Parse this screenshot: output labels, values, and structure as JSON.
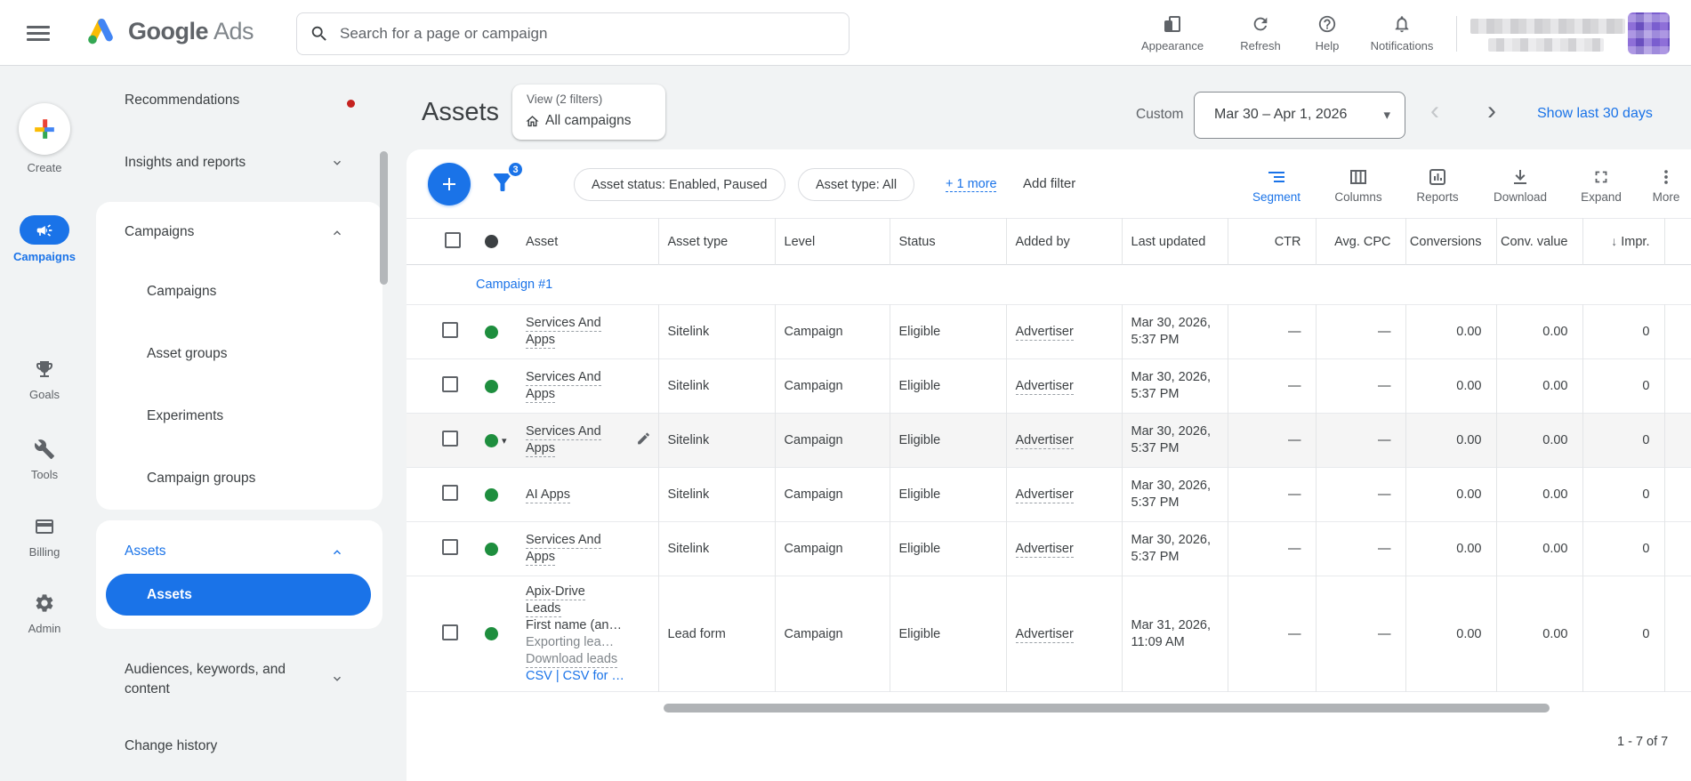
{
  "colors": {
    "accent": "#1a73e8",
    "enabled_green": "#1e8e3e",
    "alert_red": "#c5221f"
  },
  "topbar": {
    "brand_primary": "Google",
    "brand_secondary": "Ads",
    "search_placeholder": "Search for a page or campaign",
    "actions": {
      "appearance": "Appearance",
      "refresh": "Refresh",
      "help": "Help",
      "notifications": "Notifications"
    }
  },
  "rail": {
    "create": "Create",
    "campaigns": "Campaigns",
    "goals": "Goals",
    "tools": "Tools",
    "billing": "Billing",
    "admin": "Admin"
  },
  "sidebar": {
    "recommendations": "Recommendations",
    "insights": "Insights and reports",
    "campaigns_header": "Campaigns",
    "campaigns_items": [
      "Campaigns",
      "Asset groups",
      "Experiments",
      "Campaign groups"
    ],
    "assets_header": "Assets",
    "assets_selected": "Assets",
    "audiences_line1": "Audiences, keywords, and",
    "audiences_line2": "content",
    "change_history": "Change history"
  },
  "header": {
    "title": "Assets",
    "view_label": "View (2 filters)",
    "view_scope": "All campaigns",
    "date_mode": "Custom",
    "date_range": "Mar 30 – Apr 1, 2026",
    "show_last": "Show last 30 days"
  },
  "toolbar": {
    "filter_badge": "3",
    "chip1": "Asset status: Enabled, Paused",
    "chip2": "Asset type: All",
    "more_filters": "+ 1 more",
    "add_filter": "Add filter",
    "tools": {
      "segment": "Segment",
      "columns": "Columns",
      "reports": "Reports",
      "download": "Download",
      "expand": "Expand",
      "more": "More"
    }
  },
  "table": {
    "headers": {
      "asset": "Asset",
      "asset_type": "Asset type",
      "level": "Level",
      "status": "Status",
      "added_by": "Added by",
      "last_updated": "Last updated",
      "ctr": "CTR",
      "avg_cpc": "Avg. CPC",
      "conversions": "Conversions",
      "conv_value": "Conv. value",
      "impr": "Impr.",
      "sort_arrow": "↓"
    },
    "group": "Campaign #1",
    "rows": [
      {
        "a1": "Services And",
        "a2": "Apps",
        "type": "Sitelink",
        "level": "Campaign",
        "status": "Eligible",
        "added": "Advertiser",
        "d1": "Mar 30, 2026,",
        "d2": "5:37 PM",
        "ctr": "—",
        "cpc": "—",
        "conv": "0.00",
        "cval": "0.00",
        "impr": "0"
      },
      {
        "a1": "Services And",
        "a2": "Apps",
        "type": "Sitelink",
        "level": "Campaign",
        "status": "Eligible",
        "added": "Advertiser",
        "d1": "Mar 30, 2026,",
        "d2": "5:37 PM",
        "ctr": "—",
        "cpc": "—",
        "conv": "0.00",
        "cval": "0.00",
        "impr": "0"
      },
      {
        "a1": "Services And",
        "a2": "Apps",
        "type": "Sitelink",
        "level": "Campaign",
        "status": "Eligible",
        "added": "Advertiser",
        "d1": "Mar 30, 2026,",
        "d2": "5:37 PM",
        "ctr": "—",
        "cpc": "—",
        "conv": "0.00",
        "cval": "0.00",
        "impr": "0"
      },
      {
        "a1": "AI Apps",
        "a2": "",
        "type": "Sitelink",
        "level": "Campaign",
        "status": "Eligible",
        "added": "Advertiser",
        "d1": "Mar 30, 2026,",
        "d2": "5:37 PM",
        "ctr": "—",
        "cpc": "—",
        "conv": "0.00",
        "cval": "0.00",
        "impr": "0"
      },
      {
        "a1": "Services And",
        "a2": "Apps",
        "type": "Sitelink",
        "level": "Campaign",
        "status": "Eligible",
        "added": "Advertiser",
        "d1": "Mar 30, 2026,",
        "d2": "5:37 PM",
        "ctr": "—",
        "cpc": "—",
        "conv": "0.00",
        "cval": "0.00",
        "impr": "0"
      },
      {
        "lead": {
          "l1": "Apix-Drive",
          "l2": "Leads",
          "l3": "First name (an…",
          "l4": "Exporting lea…",
          "l5": "Download leads",
          "links": "CSV | CSV for …"
        },
        "type": "Lead form",
        "level": "Campaign",
        "status": "Eligible",
        "added": "Advertiser",
        "d1": "Mar 31, 2026,",
        "d2": "11:09 AM",
        "ctr": "—",
        "cpc": "—",
        "conv": "0.00",
        "cval": "0.00",
        "impr": "0"
      }
    ],
    "pagination": "1 - 7 of 7"
  },
  "glyphs": {
    "caret_down": "▾",
    "chev_left": "‹",
    "chev_right": "›"
  }
}
